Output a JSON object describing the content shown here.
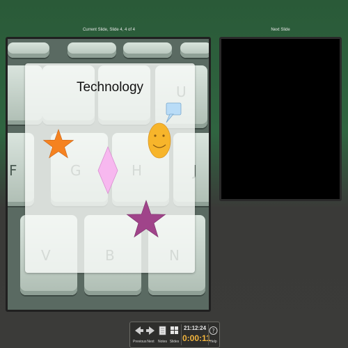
{
  "current_panel": {
    "label": "Current Slide, Slide 4, 4 of 4"
  },
  "next_panel": {
    "label": "Next Slide"
  },
  "slide": {
    "title": "Technology",
    "keys": [
      "G",
      "H",
      "J",
      "U",
      "F",
      "V",
      "B",
      "N"
    ],
    "shapes": [
      "orange-star",
      "pink-diamond",
      "smiley-face",
      "speech-bubble",
      "purple-star"
    ]
  },
  "toolbar": {
    "previous_label": "Previous",
    "next_label": "Next",
    "notes_label": "Notes",
    "slides_label": "Slides",
    "help_label": "Help",
    "clock": "21:12:24",
    "timer": "0:00:11"
  },
  "colors": {
    "timer": "#f3b53d",
    "orange_star": "#f58220",
    "purple_star": "#a0448a",
    "diamond": "#f7b8ef",
    "smiley": "#f7b52b",
    "bubble": "#b9dcf7"
  }
}
